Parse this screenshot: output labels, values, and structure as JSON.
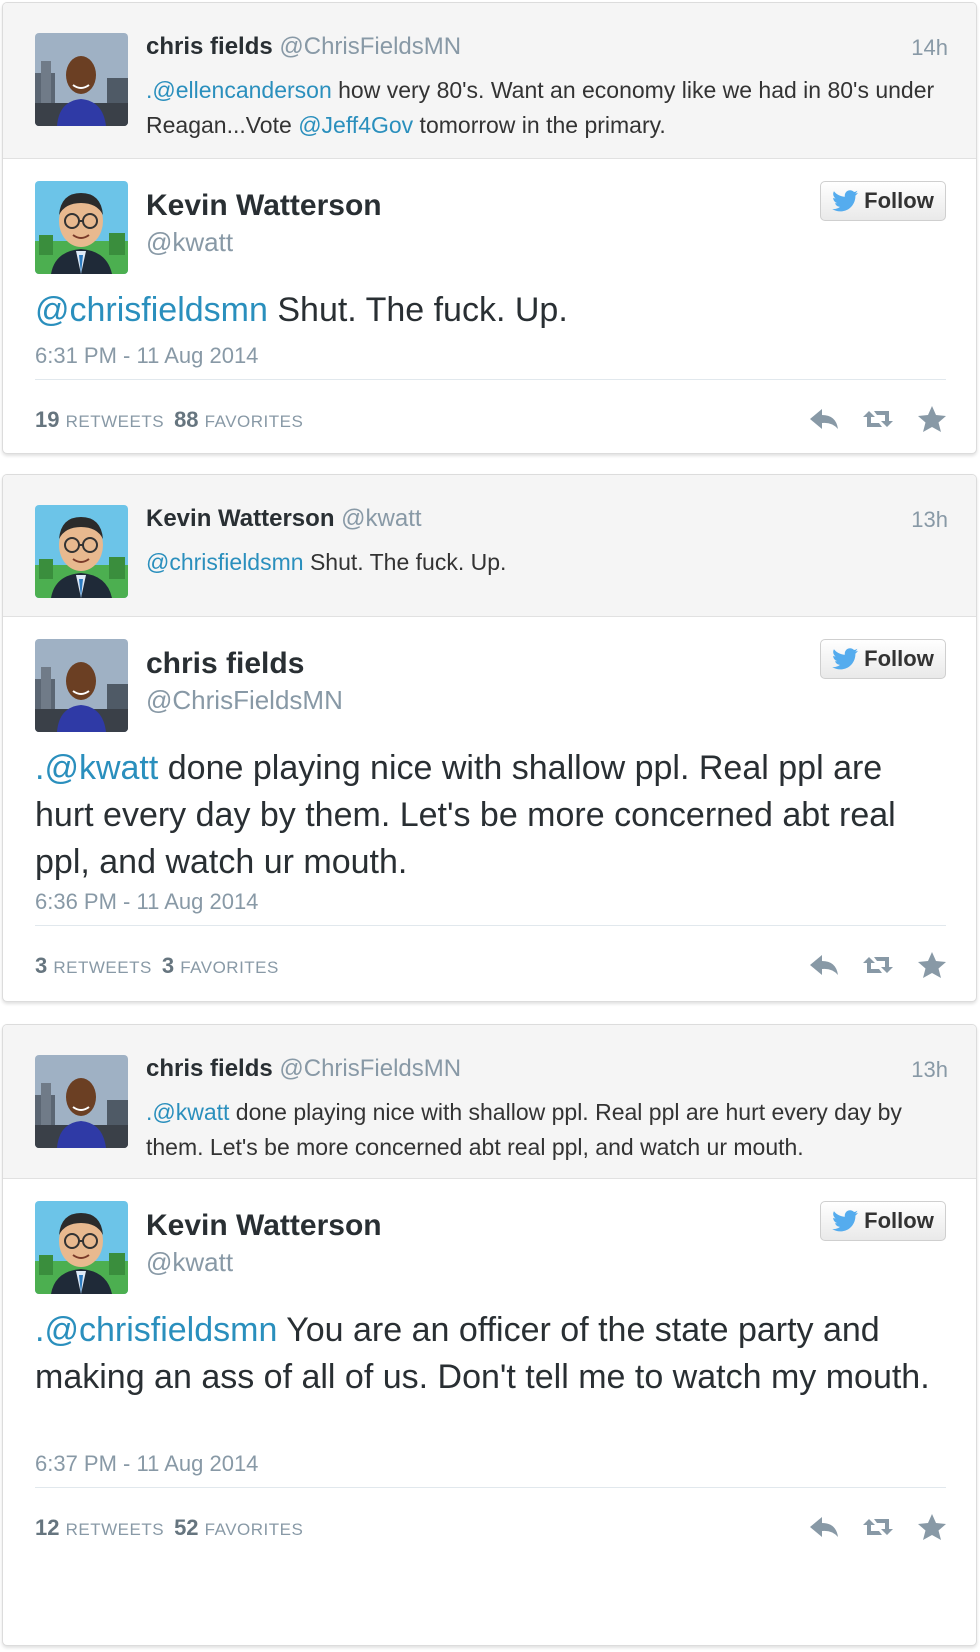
{
  "colors": {
    "mention": "#2a8fbd",
    "muted": "#8899a6",
    "twitter_blue": "#55acee"
  },
  "follow_label": "Follow",
  "cards": [
    {
      "context": {
        "name": "chris fields",
        "handle": "@ChrisFieldsMN",
        "time": "14h",
        "mention1": ".@ellencanderson",
        "text1": " how very 80's. Want an economy like we had in 80's under Reagan...Vote ",
        "mention2": "@Jeff4Gov",
        "text2": " tomorrow in the primary.",
        "avatar": "chris-fields-avatar"
      },
      "tweet": {
        "name": "Kevin Watterson",
        "handle": "@kwatt",
        "mention": "@chrisfieldsmn",
        "text": " Shut. The fuck. Up.",
        "date": "6:31 PM - 11 Aug 2014",
        "retweets": "19",
        "retweets_label": "RETWEETS",
        "favorites": "88",
        "favorites_label": "FAVORITES",
        "avatar": "kevin-watterson-avatar"
      }
    },
    {
      "context": {
        "name": "Kevin Watterson",
        "handle": "@kwatt",
        "time": "13h",
        "mention1": "@chrisfieldsmn",
        "text1": " Shut. The fuck. Up.",
        "mention2": "",
        "text2": "",
        "avatar": "kevin-watterson-avatar"
      },
      "tweet": {
        "name": "chris fields",
        "handle": "@ChrisFieldsMN",
        "mention": ".@kwatt",
        "text": " done playing nice with shallow ppl. Real ppl are hurt every day by them. Let's be more concerned abt real ppl, and watch ur mouth.",
        "date": "6:36 PM - 11 Aug 2014",
        "retweets": "3",
        "retweets_label": "RETWEETS",
        "favorites": "3",
        "favorites_label": "FAVORITES",
        "avatar": "chris-fields-avatar"
      }
    },
    {
      "context": {
        "name": "chris fields",
        "handle": "@ChrisFieldsMN",
        "time": "13h",
        "mention1": ".@kwatt",
        "text1": " done playing nice with shallow ppl. Real ppl are hurt every day by them. Let's be more concerned abt real ppl, and watch ur mouth.",
        "mention2": "",
        "text2": "",
        "avatar": "chris-fields-avatar"
      },
      "tweet": {
        "name": "Kevin Watterson",
        "handle": "@kwatt",
        "mention": ".@chrisfieldsmn",
        "text": " You are an officer of the state party and making an ass of all of us. Don't tell me to watch my mouth.",
        "date": "6:37 PM - 11 Aug 2014",
        "retweets": "12",
        "retweets_label": "RETWEETS",
        "favorites": "52",
        "favorites_label": "FAVORITES",
        "avatar": "kevin-watterson-avatar"
      }
    }
  ]
}
